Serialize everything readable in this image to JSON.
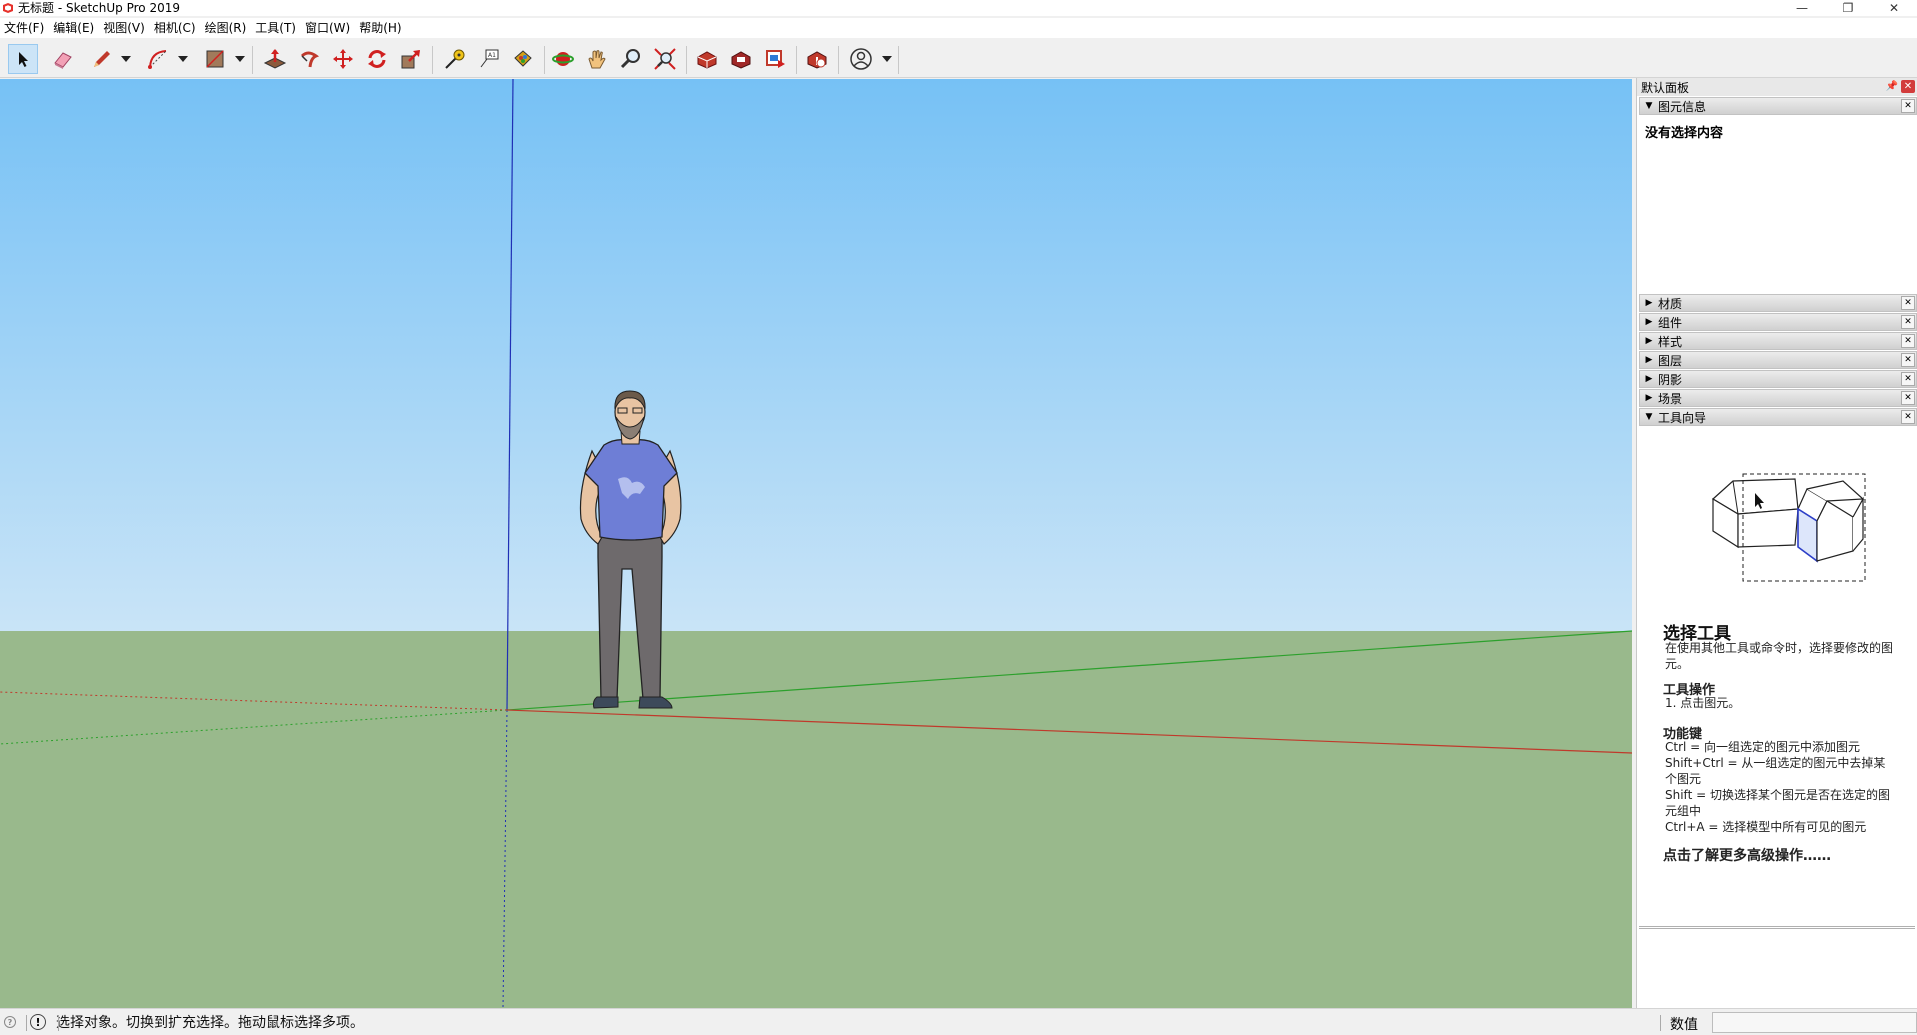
{
  "window": {
    "title": "无标题 - SketchUp Pro 2019",
    "minimize": "—",
    "restore": "❐",
    "close": "✕"
  },
  "menu": [
    "文件(F)",
    "编辑(E)",
    "视图(V)",
    "相机(C)",
    "绘图(R)",
    "工具(T)",
    "窗口(W)",
    "帮助(H)"
  ],
  "toolbar": {
    "tools": [
      "select",
      "eraser",
      "line",
      "arc",
      "shape",
      "push-pull",
      "follow-me",
      "move",
      "rotate",
      "scale",
      "tape-measure",
      "text",
      "paint-bucket",
      "orbit",
      "pan",
      "zoom",
      "zoom-extents",
      "warehouse",
      "extension-warehouse",
      "layout",
      "extension-manager",
      "account"
    ],
    "active": "select"
  },
  "colors": {
    "sky_top": "#76c1f5",
    "sky_bottom": "#c9e4f7",
    "ground": "#99b98c",
    "axis_red": "#c0392b",
    "axis_green": "#2ca02c",
    "axis_blue": "#1f2fb5"
  },
  "panel": {
    "title": "默认面板",
    "entity_info": {
      "label": "图元信息",
      "empty_text": "没有选择内容"
    },
    "trays": [
      "材质",
      "组件",
      "样式",
      "图层",
      "阴影",
      "场景"
    ],
    "instructor": {
      "label": "工具向导",
      "title": "选择工具",
      "intro": "在使用其他工具或命令时，选择要修改的图元。",
      "ops_heading": "工具操作",
      "ops_text": "1. 点击图元。",
      "keys_heading": "功能键",
      "keys": [
        "Ctrl = 向一组选定的图元中添加图元",
        "Shift+Ctrl = 从一组选定的图元中去掉某个图元",
        "Shift = 切换选择某个图元是否在选定的图元组中",
        "Ctrl+A = 选择模型中所有可见的图元"
      ],
      "more_link": "点击了解更多高级操作……"
    }
  },
  "status": {
    "text": "选择对象。切换到扩充选择。拖动鼠标选择多项。",
    "measure_label": "数值",
    "measure_value": ""
  }
}
